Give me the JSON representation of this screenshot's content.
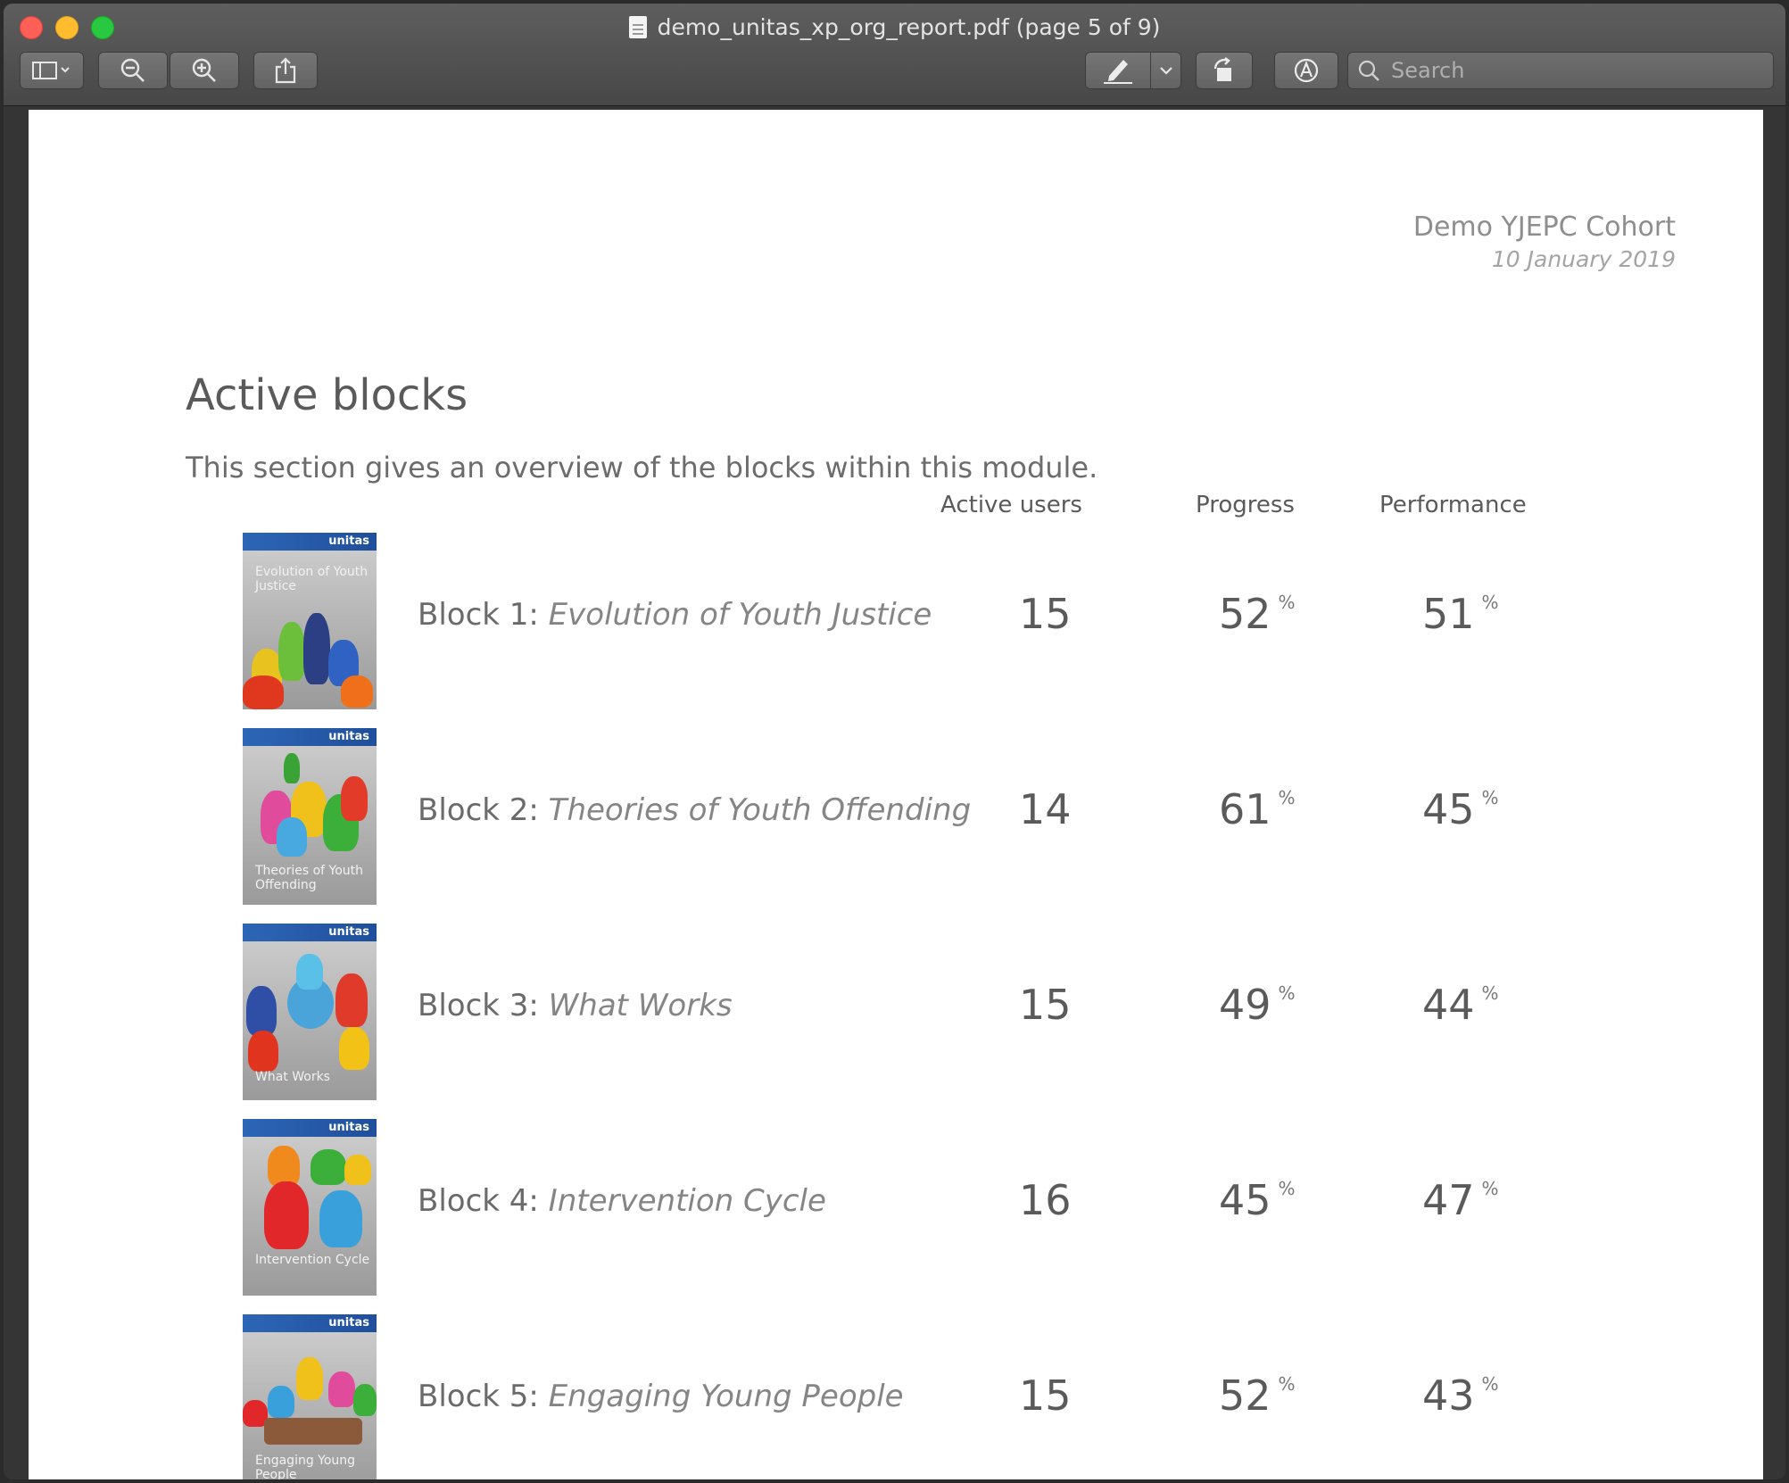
{
  "window": {
    "title": "demo_unitas_xp_org_report.pdf (page 5 of 9)",
    "search_placeholder": "Search"
  },
  "toolbar": {
    "sidebar_icon": "sidebar-toggle-icon",
    "zoom_out_icon": "zoom-out-icon",
    "zoom_in_icon": "zoom-in-icon",
    "share_icon": "share-icon",
    "markup_icon": "highlighter-icon",
    "rotate_icon": "rotate-icon",
    "annotate_icon": "markup-toolbar-icon"
  },
  "report": {
    "cohort": "Demo YJEPC Cohort",
    "date": "10 January 2019",
    "section_title": "Active blocks",
    "section_desc": "This section gives an overview of the blocks within this module.",
    "headers": {
      "active_users": "Active users",
      "progress": "Progress",
      "performance": "Performance"
    },
    "pct_symbol": "%",
    "blocks": [
      {
        "prefix": "Block 1: ",
        "name": "Evolution of Youth Justice",
        "cover": "Evolution of Youth Justice",
        "active_users": "15",
        "progress": "52",
        "performance": "51"
      },
      {
        "prefix": "Block 2: ",
        "name": "Theories of Youth Offending",
        "cover": "Theories of Youth Offending",
        "active_users": "14",
        "progress": "61",
        "performance": "45"
      },
      {
        "prefix": "Block 3: ",
        "name": "What Works",
        "cover": "What Works",
        "active_users": "15",
        "progress": "49",
        "performance": "44"
      },
      {
        "prefix": "Block 4: ",
        "name": "Intervention Cycle",
        "cover": "Intervention Cycle",
        "active_users": "16",
        "progress": "45",
        "performance": "47"
      },
      {
        "prefix": "Block 5: ",
        "name": "Engaging Young People",
        "cover": "Engaging Young People",
        "active_users": "15",
        "progress": "52",
        "performance": "43"
      }
    ],
    "cover_brand": "unitas"
  },
  "colors": {
    "brand_blue": "#2d66b6",
    "close": "#fe5f57",
    "minimize": "#febc2e",
    "maximize": "#28c840"
  }
}
